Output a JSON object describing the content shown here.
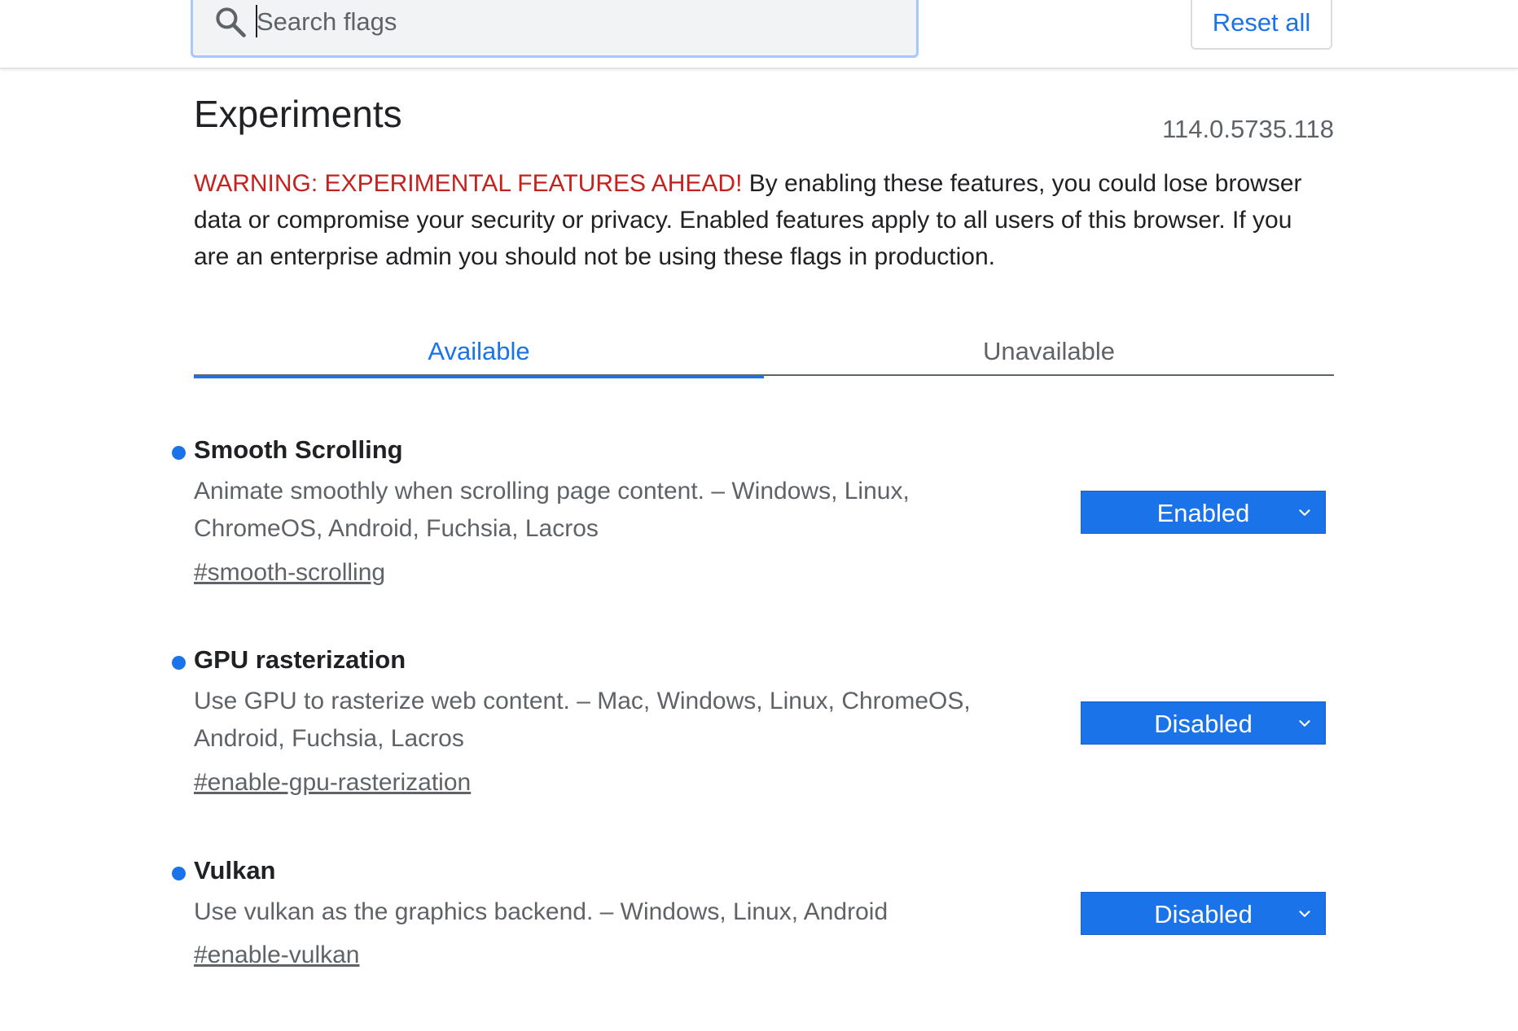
{
  "search": {
    "placeholder": "Search flags",
    "value": ""
  },
  "header": {
    "reset_label": "Reset all"
  },
  "main": {
    "title": "Experiments",
    "version": "114.0.5735.118",
    "warning_strong": "WARNING: EXPERIMENTAL FEATURES AHEAD!",
    "warning_text": " By enabling these features, you could lose browser data or compromise your security or privacy. Enabled features apply to all users of this browser. If you are an enterprise admin you should not be using these flags in production."
  },
  "tabs": [
    {
      "label": "Available",
      "selected": true
    },
    {
      "label": "Unavailable",
      "selected": false
    }
  ],
  "experiments": [
    {
      "name": "Smooth Scrolling",
      "description": "Animate smoothly when scrolling page content. – Windows, Linux, ChromeOS, Android, Fuchsia, Lacros",
      "link": "#smooth-scrolling",
      "value": "Enabled"
    },
    {
      "name": "GPU rasterization",
      "description": "Use GPU to rasterize web content. – Mac, Windows, Linux, ChromeOS, Android, Fuchsia, Lacros",
      "link": "#enable-gpu-rasterization",
      "value": "Disabled"
    },
    {
      "name": "Vulkan",
      "description": "Use vulkan as the graphics backend. – Windows, Linux, Android",
      "link": "#enable-vulkan",
      "value": "Disabled"
    }
  ],
  "colors": {
    "accent": "#1a73e8",
    "warning": "#c5221f",
    "secondary_text": "#5f6368",
    "primary_text": "#202124"
  },
  "icons": {
    "search": "search-icon",
    "dropdown": "chevron-down-icon",
    "modified_indicator": "dot-icon"
  }
}
